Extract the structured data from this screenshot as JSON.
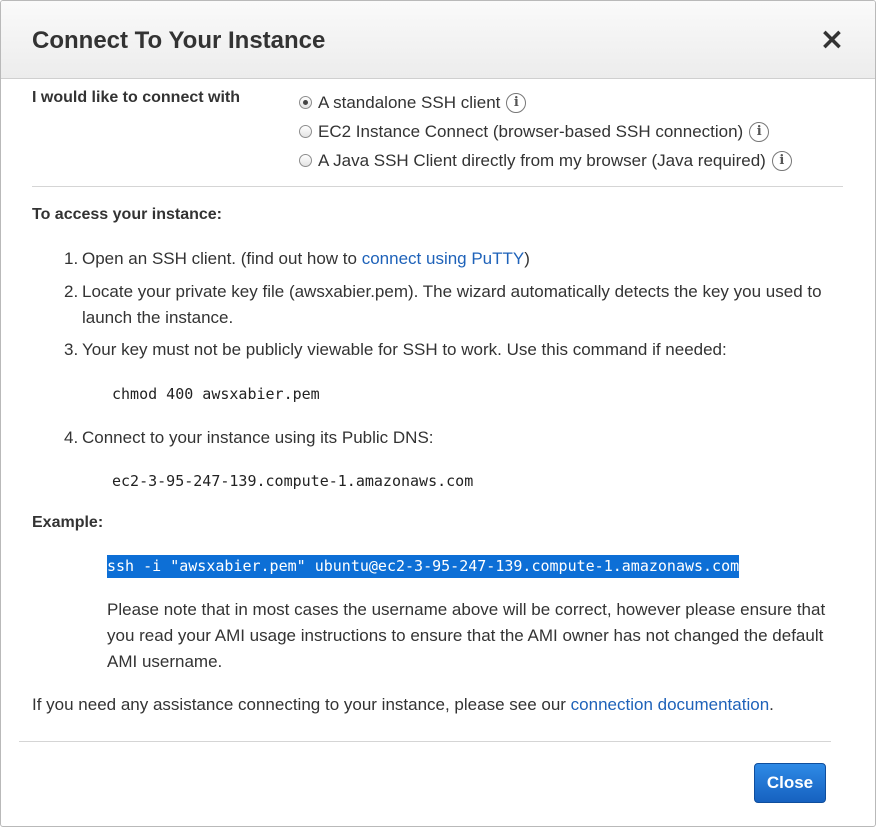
{
  "dialog": {
    "title": "Connect To Your Instance",
    "close_icon": "×"
  },
  "connect_with": {
    "label": "I would like to connect with",
    "options": [
      {
        "label": "A standalone SSH client",
        "selected": true
      },
      {
        "label": "EC2 Instance Connect (browser-based SSH connection)",
        "selected": false
      },
      {
        "label": "A Java SSH Client directly from my browser (Java required)",
        "selected": false
      }
    ]
  },
  "access": {
    "title": "To access your instance:",
    "steps": [
      {
        "num": "1.",
        "text": "Open an SSH client. (find out how to ",
        "link": "connect using PuTTY",
        "after": ")"
      },
      {
        "num": "2.",
        "text": "Locate your private key file (awsxabier.pem). The wizard automatically detects the key you used to launch the instance."
      },
      {
        "num": "3.",
        "text": "Your key must not be publicly viewable for SSH to work. Use this command if needed:"
      },
      {
        "num": "4.",
        "text": "Connect to your instance using its Public DNS:"
      }
    ],
    "chmod_cmd": "chmod 400 awsxabier.pem",
    "public_dns": "ec2-3-95-247-139.compute-1.amazonaws.com"
  },
  "example": {
    "title": "Example:",
    "command": "ssh -i \"awsxabier.pem\" ubuntu@ec2-3-95-247-139.compute-1.amazonaws.com",
    "note": "Please note that in most cases the username above will be correct, however please ensure that you read your AMI usage instructions to ensure that the AMI owner has not changed the default AMI username."
  },
  "assistance": {
    "text": "If you need any assistance connecting to your instance, please see our ",
    "link": "connection documentation",
    "after": "."
  },
  "footer": {
    "close_label": "Close"
  },
  "colors": {
    "link": "#1e62b9",
    "primary_button": "#1a6fd4",
    "highlight": "#0d6fd6"
  }
}
